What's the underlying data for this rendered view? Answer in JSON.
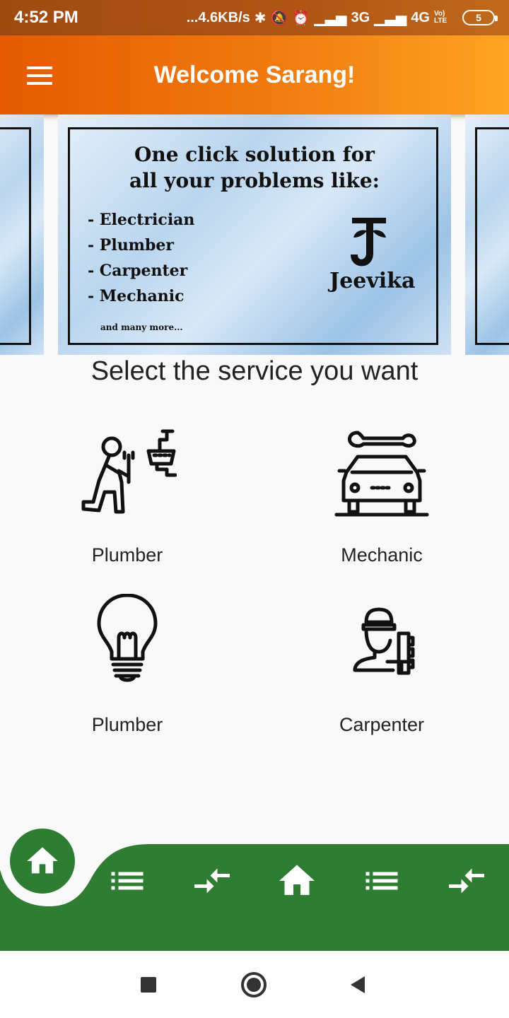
{
  "status_bar": {
    "time": "4:52 PM",
    "network_speed": "...4.6KB/s",
    "signal_1": "3G",
    "signal_2": "4G",
    "volte": "Vo) LTE",
    "battery": "5"
  },
  "app_bar": {
    "title": "Welcome Sarang!"
  },
  "banner": {
    "heading_line1": "One click solution for",
    "heading_line2": "all your problems like:",
    "items": [
      "- Electrician",
      "- Plumber",
      "- Carpenter",
      "- Mechanic"
    ],
    "more": "and many more...",
    "logo_text": "Jeevika"
  },
  "section_title": "Select the service you want",
  "services": [
    {
      "label": "Plumber",
      "icon": "plumber-icon"
    },
    {
      "label": "Mechanic",
      "icon": "mechanic-icon"
    },
    {
      "label": "Plumber",
      "icon": "lightbulb-icon"
    },
    {
      "label": "Carpenter",
      "icon": "carpenter-icon"
    }
  ],
  "bottom_nav": {
    "items": [
      "home-icon",
      "list-icon",
      "compare-arrows-icon",
      "home-icon",
      "list-icon",
      "compare-arrows-icon"
    ],
    "active": 0
  },
  "colors": {
    "accent_orange": "#f07c10",
    "nav_green": "#2e7d32",
    "status_bar": "#a04a12"
  }
}
